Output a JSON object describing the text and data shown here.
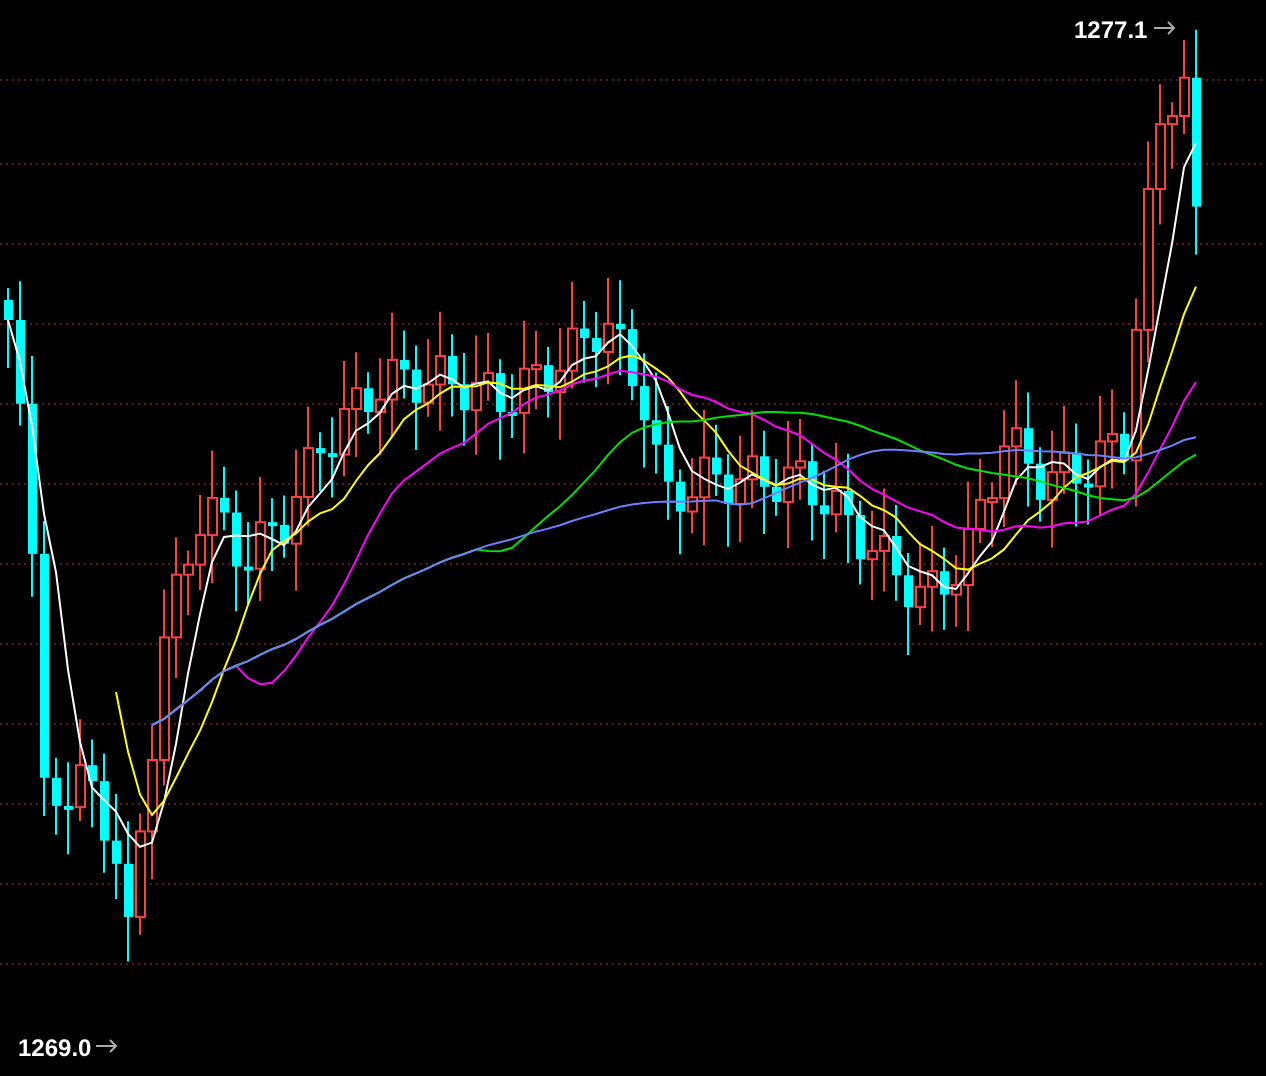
{
  "chart": {
    "high_label": "1277.1",
    "low_label": "1269.0"
  }
}
